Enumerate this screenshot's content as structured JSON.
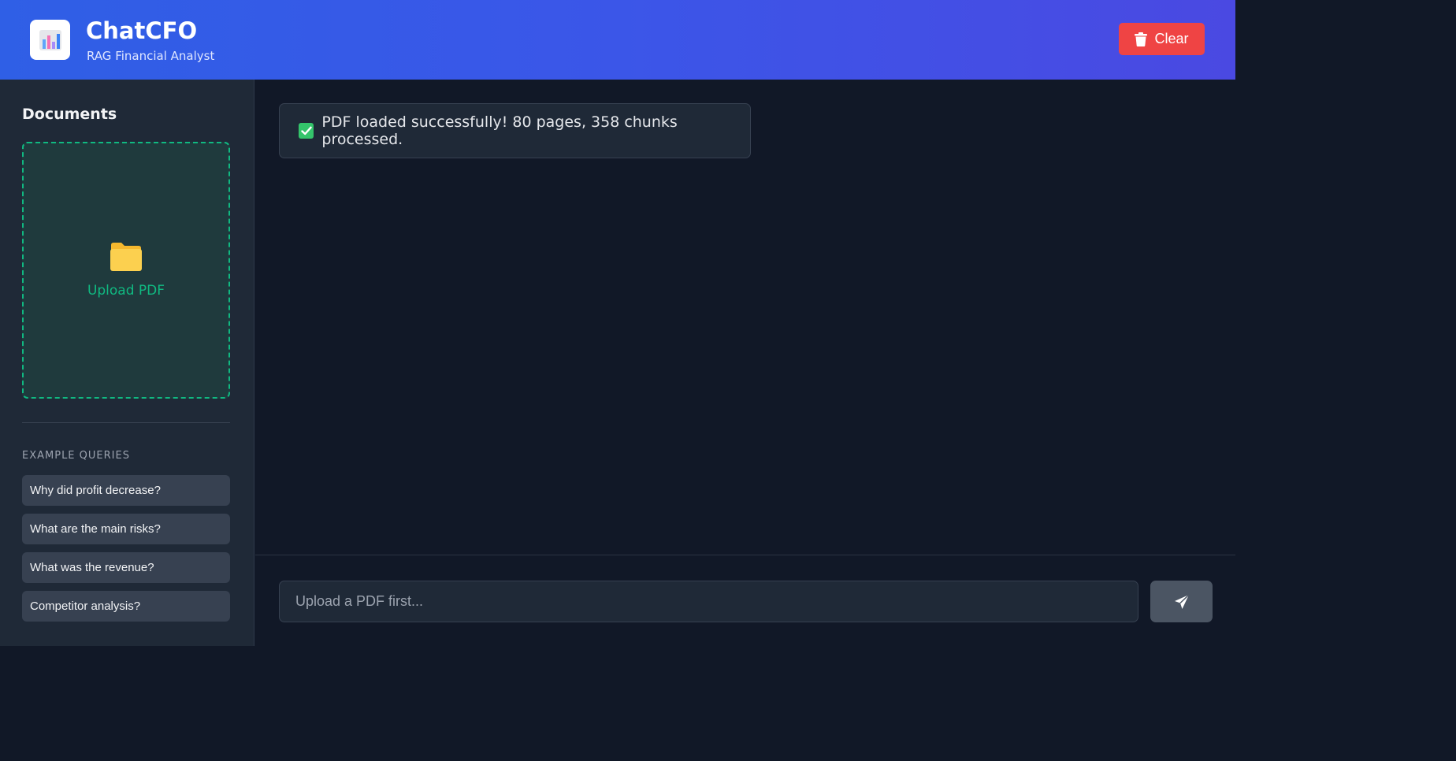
{
  "header": {
    "title": "ChatCFO",
    "subtitle": "RAG Financial Analyst",
    "logo_icon": "bar-chart-icon",
    "clear_label": "Clear",
    "clear_icon": "trash-icon",
    "clear_color": "#ef4444"
  },
  "sidebar": {
    "title": "Documents",
    "upload": {
      "icon": "folder-icon",
      "label": "Upload PDF"
    },
    "examples_title": "EXAMPLE QUERIES",
    "examples": [
      "Why did profit decrease?",
      "What are the main risks?",
      "What was the revenue?",
      "Competitor analysis?"
    ]
  },
  "main": {
    "messages": [
      {
        "icon": "check-icon",
        "text": "PDF loaded successfully! 80 pages, 358 chunks processed."
      }
    ]
  },
  "input": {
    "placeholder": "Upload a PDF first...",
    "value": "",
    "send_icon": "send-icon"
  },
  "colors": {
    "accent_green": "#10b981",
    "header_gradient_start": "#2f5fe6",
    "header_gradient_end": "#4a49e2"
  }
}
